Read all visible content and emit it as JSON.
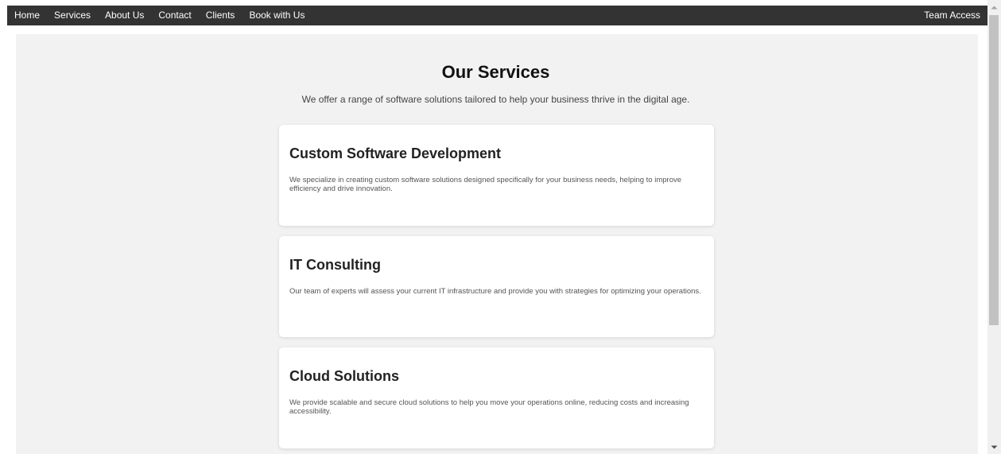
{
  "nav": {
    "items": [
      {
        "label": "Home"
      },
      {
        "label": "Services"
      },
      {
        "label": "About Us"
      },
      {
        "label": "Contact"
      },
      {
        "label": "Clients"
      },
      {
        "label": "Book with Us"
      }
    ],
    "right_label": "Team Access"
  },
  "main": {
    "title": "Our Services",
    "subtitle": "We offer a range of software solutions tailored to help your business thrive in the digital age."
  },
  "services": [
    {
      "title": "Custom Software Development",
      "description": "We specialize in creating custom software solutions designed specifically for your business needs, helping to improve efficiency and drive innovation."
    },
    {
      "title": "IT Consulting",
      "description": "Our team of experts will assess your current IT infrastructure and provide you with strategies for optimizing your operations."
    },
    {
      "title": "Cloud Solutions",
      "description": "We provide scalable and secure cloud solutions to help you move your operations online, reducing costs and increasing accessibility."
    }
  ],
  "colors": {
    "navbar": "#333333",
    "page_background": "#f2f2f2",
    "card_background": "#ffffff"
  },
  "icons": {
    "scroll_up": "chevron-up-icon",
    "scroll_down": "chevron-down-icon"
  }
}
